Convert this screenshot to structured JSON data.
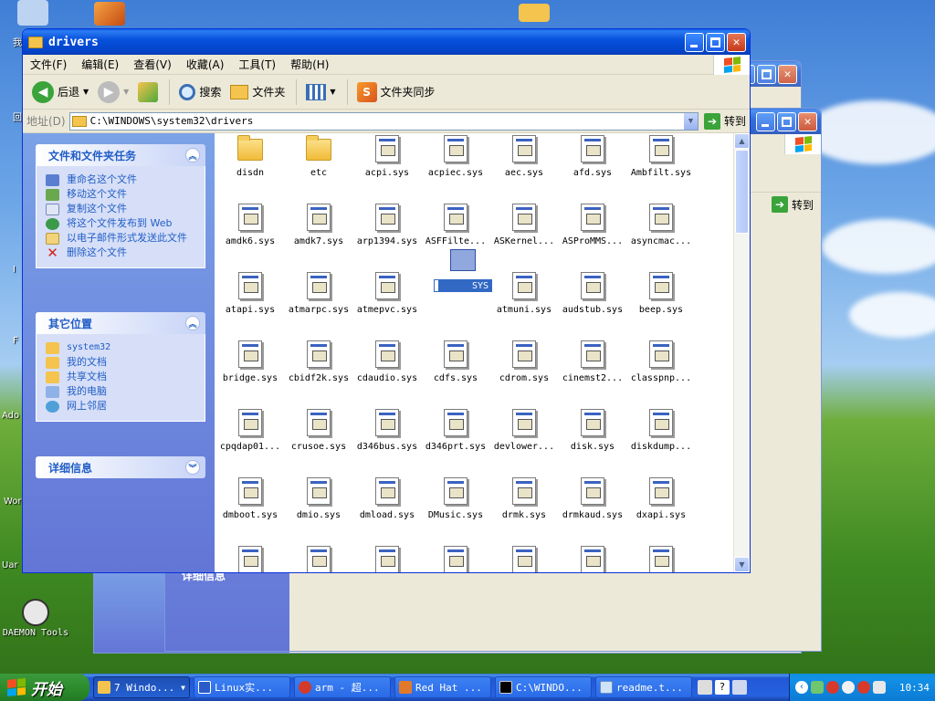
{
  "window": {
    "title": "drivers",
    "address": "C:\\WINDOWS\\system32\\drivers",
    "address_label": "地址(D)",
    "go_label": "转到"
  },
  "menu": [
    "文件(F)",
    "编辑(E)",
    "查看(V)",
    "收藏(A)",
    "工具(T)",
    "帮助(H)"
  ],
  "toolbar": {
    "back": "后退",
    "search": "搜索",
    "folders": "文件夹",
    "sync": "文件夹同步"
  },
  "back_window": {
    "go_label": "转到",
    "details_label": "详细信息"
  },
  "tasks": {
    "title": "文件和文件夹任务",
    "items": [
      "重命名这个文件",
      "移动这个文件",
      "复制这个文件",
      "将这个文件发布到 Web",
      "以电子邮件形式发送此文件",
      "删除这个文件"
    ]
  },
  "places": {
    "title": "其它位置",
    "items": [
      "system32",
      "我的文档",
      "共享文档",
      "我的电脑",
      "网上邻居"
    ]
  },
  "details": {
    "title": "详细信息"
  },
  "files": [
    "disdn",
    "etc",
    "acpi.sys",
    "acpiec.sys",
    "aec.sys",
    "afd.sys",
    "Ambfilt.sys",
    "amdk6.sys",
    "amdk7.sys",
    "arp1394.sys",
    "ASFFilte...",
    "ASKernel...",
    "ASProMMS...",
    "asyncmac...",
    "atapi.sys",
    "atmarpc.sys",
    "atmepvc.sys",
    "atmlane.sys",
    "atmuni.sys",
    "audstub.sys",
    "beep.sys",
    "bridge.sys",
    "cbidf2k.sys",
    "cdaudio.sys",
    "cdfs.sys",
    "cdrom.sys",
    "cinemst2...",
    "classpnp...",
    "cpqdap01...",
    "crusoe.sys",
    "d346bus.sys",
    "d346prt.sys",
    "devlower...",
    "disk.sys",
    "diskdump...",
    "dmboot.sys",
    "dmio.sys",
    "dmload.sys",
    "DMusic.sys",
    "drmk.sys",
    "drmkaud.sys",
    "dxapi.sys"
  ],
  "rename_text": "SYS",
  "desktop_icons": {
    "daemon": "DAEMON Tools"
  },
  "desktop_edge": [
    "我",
    "回",
    "I",
    "F",
    "Ado",
    "Wor",
    "Uar"
  ],
  "taskbar": {
    "start": "开始",
    "items": [
      "7 Windo...",
      "Linux实...",
      "arm - 超...",
      "Red Hat ...",
      "C:\\WINDO...",
      "readme.t..."
    ],
    "clock": "10:34"
  }
}
